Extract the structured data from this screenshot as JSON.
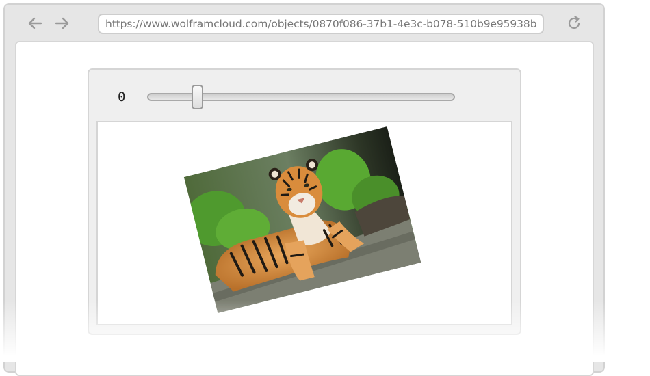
{
  "browser": {
    "url": "https://www.wolframcloud.com/objects/0870f086-37b1-4e3c-b078-510b9e95938b",
    "back_icon": "arrow-left-icon",
    "forward_icon": "arrow-right-icon",
    "reload_icon": "reload-icon"
  },
  "manipulate": {
    "slider_value": "0",
    "slider_fraction": 0.15,
    "output_image": "tiger-photo"
  },
  "colors": {
    "frame": "#e6e6e6",
    "panel": "#efefef",
    "icon": "#9a9a9a"
  }
}
